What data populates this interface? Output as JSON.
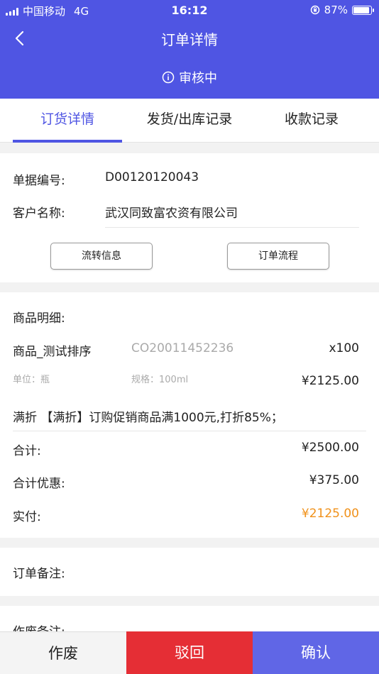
{
  "status_bar": {
    "carrier": "中国移动",
    "network": "4G",
    "time": "16:12",
    "battery_percent": "87%",
    "battery_level": 0.87
  },
  "nav": {
    "title": "订单详情",
    "back_icon": "chevron-left-icon"
  },
  "order_status": {
    "icon": "info-circle-icon",
    "label": "审核中"
  },
  "tabs": [
    {
      "label": "订货详情",
      "active": true
    },
    {
      "label": "发货/出库记录",
      "active": false
    },
    {
      "label": "收款记录",
      "active": false
    }
  ],
  "order_info": {
    "doc_no_label": "单据编号:",
    "doc_no_value": "D00120120043",
    "customer_label": "客户名称:",
    "customer_value": "武汉同致富农资有限公司",
    "flow_info_button": "流转信息",
    "order_flow_button": "订单流程"
  },
  "goods": {
    "section_label": "商品明细:",
    "item": {
      "name": "商品_测试排序",
      "code": "CO20011452236",
      "quantity": "x100",
      "unit": "单位：瓶",
      "spec": "规格：100ml",
      "price": "¥2125.00"
    },
    "promotion": "满折 【满折】订购促销商品满1000元,打折85%；",
    "total_label": "合计:",
    "total_value": "¥2500.00",
    "discount_label": "合计优惠:",
    "discount_value": "¥375.00",
    "paid_label": "实付:",
    "paid_value": "¥2125.00"
  },
  "remark": {
    "label": "订单备注:"
  },
  "void_remark": {
    "label": "作废备注:"
  },
  "bottom_bar": {
    "cancel": "作废",
    "reject": "驳回",
    "confirm": "确认"
  },
  "colors": {
    "primary": "#4f55e3",
    "reject": "#e52e35",
    "confirm": "#6066e6",
    "paid": "#f0911a"
  }
}
